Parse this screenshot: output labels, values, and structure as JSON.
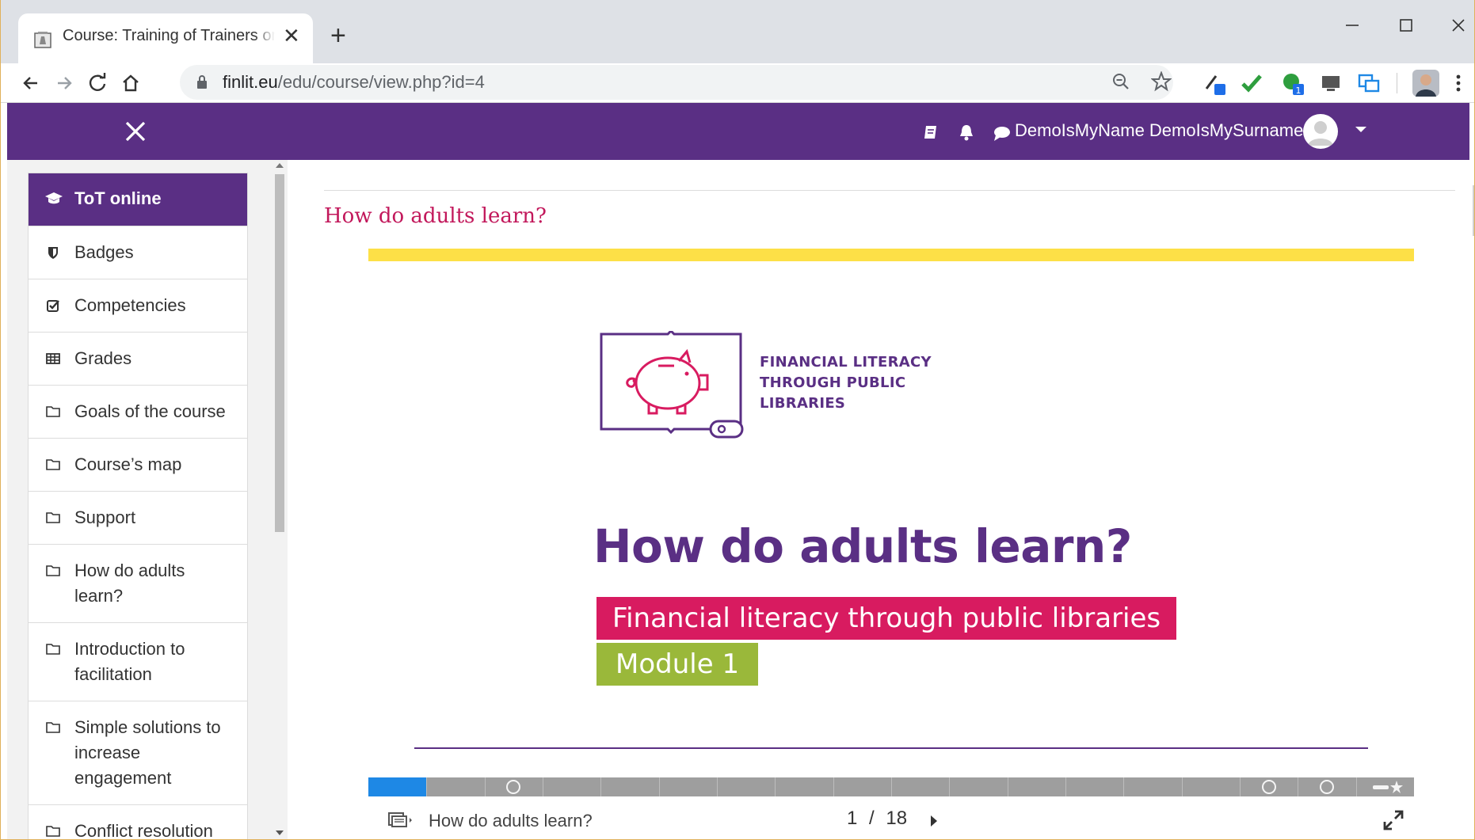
{
  "browser": {
    "tab_title": "Course: Training of Trainers online",
    "url_host": "finlit.eu",
    "url_path": "/edu/course/view.php?id=4"
  },
  "navbar": {
    "user_name": "DemoIsMyName DemoIsMySurname"
  },
  "drawer": {
    "items": [
      {
        "label": "ToT online",
        "icon": "graduation-cap-icon"
      },
      {
        "label": "Badges",
        "icon": "shield-icon"
      },
      {
        "label": "Competencies",
        "icon": "check-square-icon"
      },
      {
        "label": "Grades",
        "icon": "table-icon"
      },
      {
        "label": "Goals of the course",
        "icon": "folder-icon"
      },
      {
        "label": "Course’s map",
        "icon": "folder-icon"
      },
      {
        "label": "Support",
        "icon": "folder-icon"
      },
      {
        "label": "How do adults learn?",
        "icon": "folder-icon"
      },
      {
        "label": "Introduction to facilitation",
        "icon": "folder-icon"
      },
      {
        "label": "Simple solutions to increase engagement",
        "icon": "folder-icon"
      },
      {
        "label": "Conflict resolution",
        "icon": "folder-icon"
      }
    ]
  },
  "main": {
    "section_title": "How do adults learn?",
    "slide": {
      "logo_line1": "FINANCIAL LITERACY",
      "logo_line2": "THROUGH PUBLIC",
      "logo_line3": "LIBRARIES",
      "title": "How do adults learn?",
      "subtitle": "Financial literacy through public libraries",
      "module": "Module 1"
    },
    "presentation": {
      "footer_title": "How do adults learn?",
      "current_slide": "1",
      "separator": "/",
      "total_slides": "18",
      "progress_fraction": 0.0556
    }
  },
  "colors": {
    "navbar": "#5a2f84",
    "accent_pink": "#d81b60",
    "accent_green": "#9ab83a",
    "accent_yellow": "#fde047",
    "progress": "#1e88e5"
  }
}
